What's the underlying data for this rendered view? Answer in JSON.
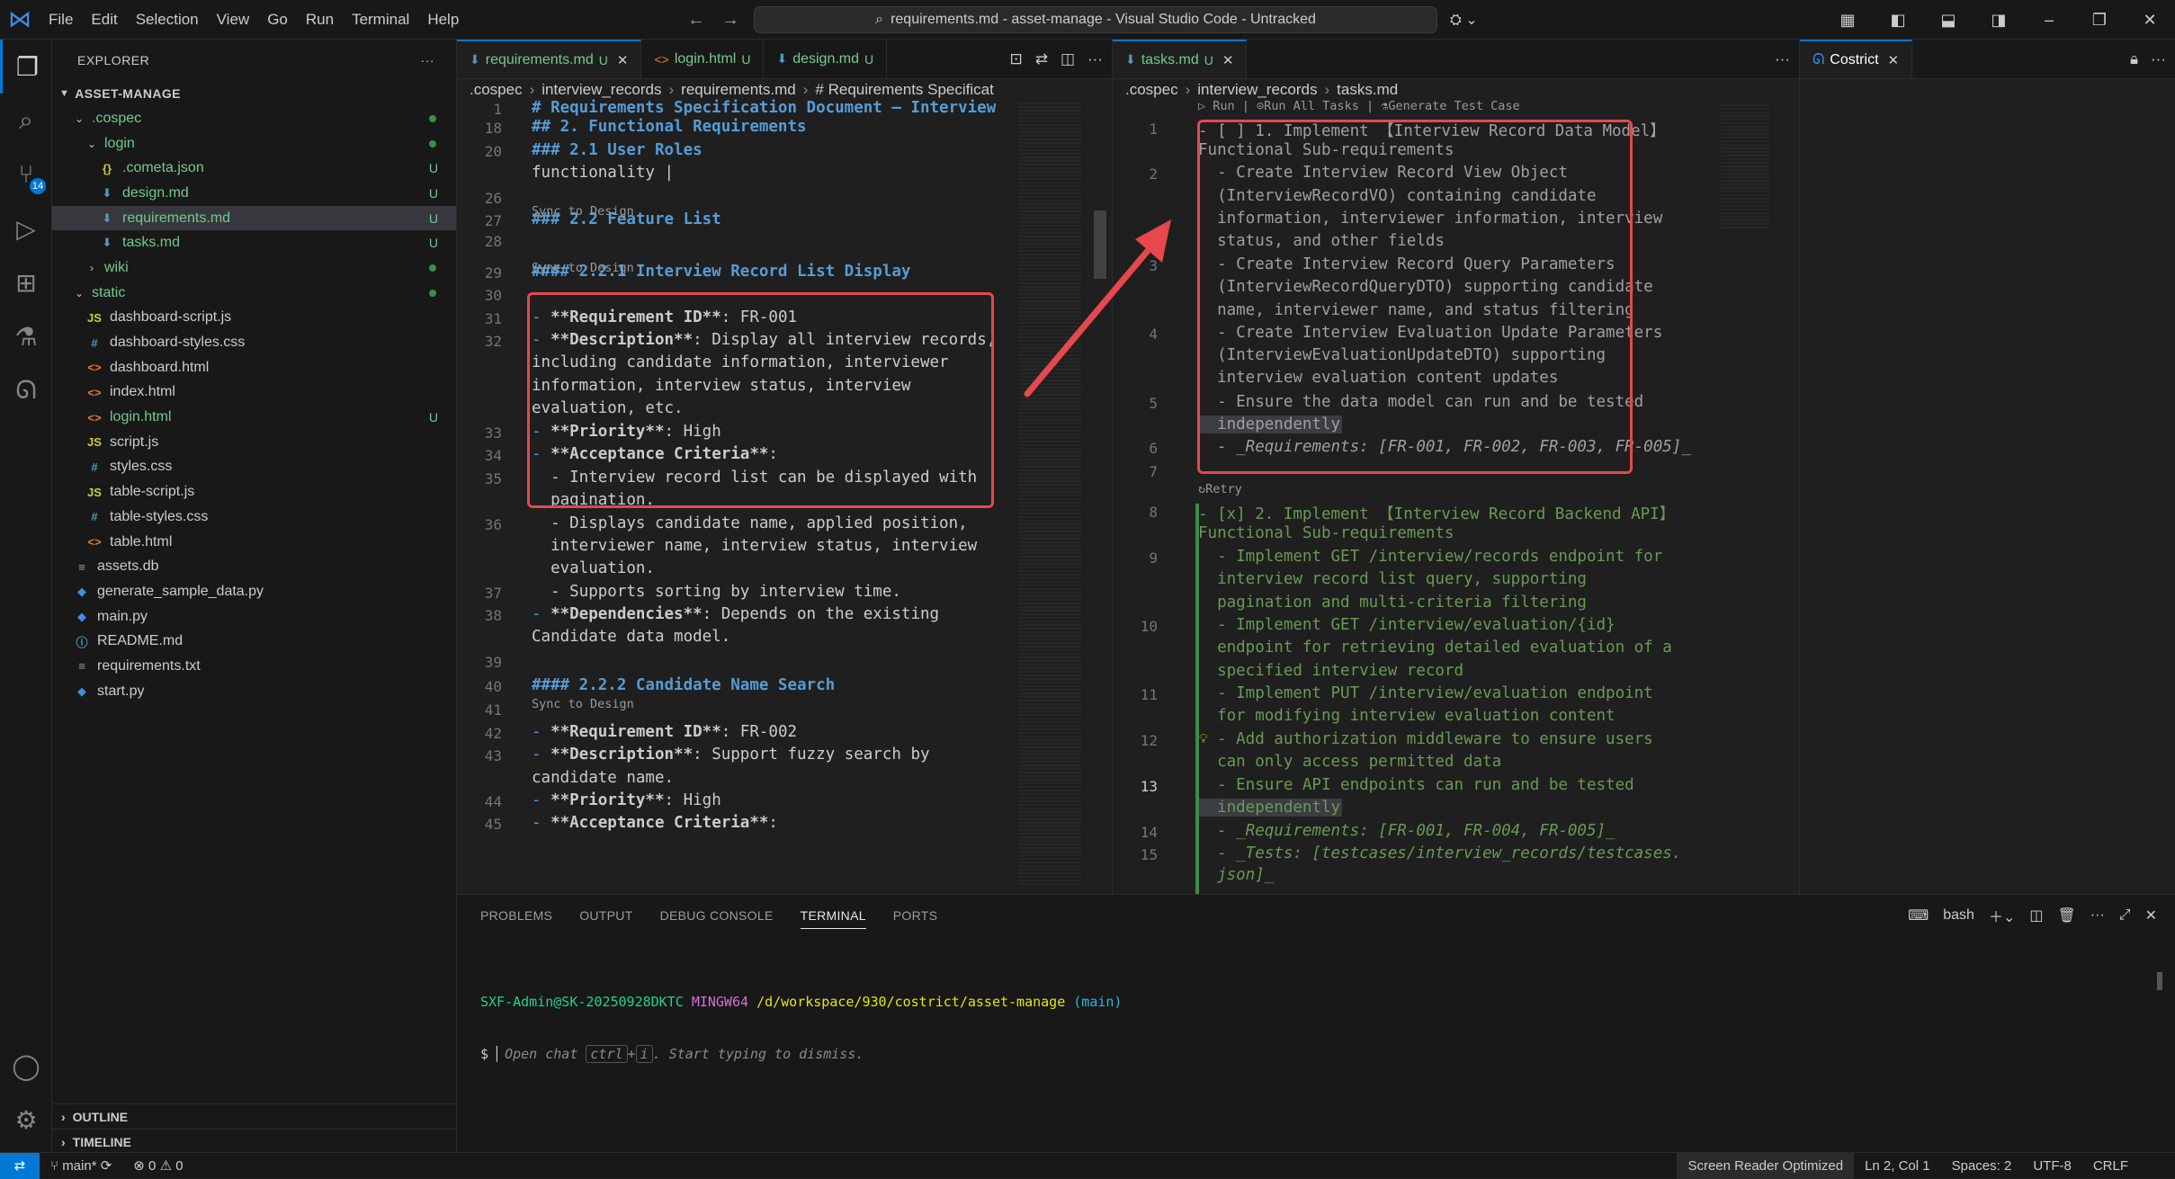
{
  "titlebar": {
    "menus": [
      "File",
      "Edit",
      "Selection",
      "View",
      "Go",
      "Run",
      "Terminal",
      "Help"
    ],
    "title": "requirements.md - asset-manage - Visual Studio Code - Untracked"
  },
  "explorer": {
    "header": "EXPLORER",
    "root": "ASSET-MANAGE",
    "items": [
      {
        "label": ".cospec",
        "kind": "folder-open",
        "depth": 1,
        "status": "dot"
      },
      {
        "label": "login",
        "kind": "folder-open",
        "depth": 2,
        "status": "dot"
      },
      {
        "label": ".cometa.json",
        "kind": "json",
        "depth": 3,
        "status": "U"
      },
      {
        "label": "design.md",
        "kind": "md",
        "depth": 3,
        "status": "U"
      },
      {
        "label": "requirements.md",
        "kind": "md",
        "depth": 3,
        "status": "U",
        "selected": true
      },
      {
        "label": "tasks.md",
        "kind": "md",
        "depth": 3,
        "status": "U"
      },
      {
        "label": "wiki",
        "kind": "folder",
        "depth": 2,
        "status": "dot"
      },
      {
        "label": "static",
        "kind": "folder-open",
        "depth": 1,
        "status": "dot"
      },
      {
        "label": "dashboard-script.js",
        "kind": "js",
        "depth": 2,
        "status": ""
      },
      {
        "label": "dashboard-styles.css",
        "kind": "css",
        "depth": 2,
        "status": ""
      },
      {
        "label": "dashboard.html",
        "kind": "html",
        "depth": 2,
        "status": ""
      },
      {
        "label": "index.html",
        "kind": "html",
        "depth": 2,
        "status": ""
      },
      {
        "label": "login.html",
        "kind": "html",
        "depth": 2,
        "status": "U"
      },
      {
        "label": "script.js",
        "kind": "js",
        "depth": 2,
        "status": ""
      },
      {
        "label": "styles.css",
        "kind": "css",
        "depth": 2,
        "status": ""
      },
      {
        "label": "table-script.js",
        "kind": "js",
        "depth": 2,
        "status": ""
      },
      {
        "label": "table-styles.css",
        "kind": "css",
        "depth": 2,
        "status": ""
      },
      {
        "label": "table.html",
        "kind": "html",
        "depth": 2,
        "status": ""
      },
      {
        "label": "assets.db",
        "kind": "db",
        "depth": 1,
        "status": ""
      },
      {
        "label": "generate_sample_data.py",
        "kind": "py",
        "depth": 1,
        "status": ""
      },
      {
        "label": "main.py",
        "kind": "py",
        "depth": 1,
        "status": ""
      },
      {
        "label": "README.md",
        "kind": "info",
        "depth": 1,
        "status": ""
      },
      {
        "label": "requirements.txt",
        "kind": "txt",
        "depth": 1,
        "status": ""
      },
      {
        "label": "start.py",
        "kind": "py",
        "depth": 1,
        "status": ""
      }
    ],
    "outline": "OUTLINE",
    "timeline": "TIMELINE"
  },
  "left_editor": {
    "tabs": [
      {
        "label": "requirements.md",
        "status": "U",
        "active": true
      },
      {
        "label": "login.html",
        "status": "U",
        "active": false
      },
      {
        "label": "design.md",
        "status": "U",
        "active": false
      }
    ],
    "breadcrumb": [
      ".cospec",
      "interview_records",
      "requirements.md",
      "# Requirements Specificat"
    ],
    "lens_label": "Sync to Design",
    "lines": [
      {
        "n": "1",
        "t": "# Requirements Specification Document – Interview",
        "c": "h"
      },
      {
        "n": "18",
        "t": "## 2. Functional Requirements",
        "c": "h"
      },
      {
        "n": "20",
        "t": "### 2.1 User Roles",
        "c": "h"
      },
      {
        "n": "",
        "t": "functionality |",
        "c": ""
      },
      {
        "n": "26",
        "t": "",
        "c": ""
      },
      {
        "n": "27",
        "t": "### 2.2 Feature List",
        "c": "h"
      },
      {
        "n": "28",
        "t": "",
        "c": ""
      },
      {
        "n": "29",
        "t": "#### 2.2.1 Interview Record List Display",
        "c": "h"
      },
      {
        "n": "30",
        "t": "",
        "c": ""
      },
      {
        "n": "31",
        "t": "- **Requirement ID**: FR-001",
        "c": "b"
      },
      {
        "n": "32",
        "t": "- **Description**: Display all interview records,",
        "c": "b"
      },
      {
        "n": "",
        "t": "including candidate information, interviewer",
        "c": ""
      },
      {
        "n": "",
        "t": "information, interview status, interview",
        "c": ""
      },
      {
        "n": "",
        "t": "evaluation, etc.",
        "c": ""
      },
      {
        "n": "33",
        "t": "- **Priority**: High",
        "c": "b"
      },
      {
        "n": "34",
        "t": "- **Acceptance Criteria**:",
        "c": "b"
      },
      {
        "n": "35",
        "t": "  - Interview record list can be displayed with",
        "c": ""
      },
      {
        "n": "",
        "t": "  pagination.",
        "c": ""
      },
      {
        "n": "36",
        "t": "  - Displays candidate name, applied position,",
        "c": ""
      },
      {
        "n": "",
        "t": "  interviewer name, interview status, interview",
        "c": ""
      },
      {
        "n": "",
        "t": "  evaluation.",
        "c": ""
      },
      {
        "n": "37",
        "t": "  - Supports sorting by interview time.",
        "c": ""
      },
      {
        "n": "38",
        "t": "- **Dependencies**: Depends on the existing",
        "c": "b"
      },
      {
        "n": "",
        "t": "Candidate data model.",
        "c": ""
      },
      {
        "n": "39",
        "t": "",
        "c": ""
      },
      {
        "n": "40",
        "t": "#### 2.2.2 Candidate Name Search",
        "c": "h"
      },
      {
        "n": "41",
        "t": "",
        "c": ""
      },
      {
        "n": "42",
        "t": "- **Requirement ID**: FR-002",
        "c": "b"
      },
      {
        "n": "43",
        "t": "- **Description**: Support fuzzy search by",
        "c": "b"
      },
      {
        "n": "",
        "t": "candidate name.",
        "c": ""
      },
      {
        "n": "44",
        "t": "- **Priority**: High",
        "c": "b"
      },
      {
        "n": "45",
        "t": "- **Acceptance Criteria**:",
        "c": "b"
      }
    ]
  },
  "right_editor": {
    "tabs": [
      {
        "label": "tasks.md",
        "status": "U",
        "active": true
      }
    ],
    "breadcrumb": [
      ".cospec",
      "interview_records",
      "tasks.md"
    ],
    "codelens": [
      "▷ Run",
      "⊙Run All Tasks",
      "⚗Generate Test Case"
    ],
    "retry_label": "↻Retry",
    "lines": [
      {
        "n": "1",
        "t": "- [ ] 1. Implement 【Interview Record Data Model】",
        "c": "gr"
      },
      {
        "n": "",
        "t": "Functional Sub-requirements",
        "c": "gr"
      },
      {
        "n": "2",
        "t": "  - Create Interview Record View Object",
        "c": "gr"
      },
      {
        "n": "",
        "t": "  (InterviewRecordVO) containing candidate",
        "c": "gr"
      },
      {
        "n": "",
        "t": "  information, interviewer information, interview",
        "c": "gr"
      },
      {
        "n": "",
        "t": "  status, and other fields",
        "c": "gr"
      },
      {
        "n": "3",
        "t": "  - Create Interview Record Query Parameters",
        "c": "gr"
      },
      {
        "n": "",
        "t": "  (InterviewRecordQueryDTO) supporting candidate",
        "c": "gr"
      },
      {
        "n": "",
        "t": "  name, interviewer name, and status filtering",
        "c": "gr"
      },
      {
        "n": "4",
        "t": "  - Create Interview Evaluation Update Parameters",
        "c": "gr"
      },
      {
        "n": "",
        "t": "  (InterviewEvaluationUpdateDTO) supporting",
        "c": "gr"
      },
      {
        "n": "",
        "t": "  interview evaluation content updates",
        "c": "gr"
      },
      {
        "n": "5",
        "t": "  - Ensure the data model can run and be tested",
        "c": "gr"
      },
      {
        "n": "",
        "t": "  independently",
        "c": "gr-sel"
      },
      {
        "n": "6",
        "t": "  - _Requirements: [FR-001, FR-002, FR-003, FR-005]_",
        "c": "gr-i"
      },
      {
        "n": "7",
        "t": "",
        "c": ""
      },
      {
        "n": "8",
        "t": "- [x] 2. Implement 【Interview Record Backend API】",
        "c": "g"
      },
      {
        "n": "",
        "t": "Functional Sub-requirements",
        "c": "g"
      },
      {
        "n": "9",
        "t": "  - Implement GET /interview/records endpoint for",
        "c": "g"
      },
      {
        "n": "",
        "t": "  interview record list query, supporting",
        "c": "g"
      },
      {
        "n": "",
        "t": "  pagination and multi-criteria filtering",
        "c": "g"
      },
      {
        "n": "10",
        "t": "  - Implement GET /interview/evaluation/{id}",
        "c": "g"
      },
      {
        "n": "",
        "t": "  endpoint for retrieving detailed evaluation of a",
        "c": "g"
      },
      {
        "n": "",
        "t": "  specified interview record",
        "c": "g"
      },
      {
        "n": "11",
        "t": "  - Implement PUT /interview/evaluation endpoint",
        "c": "g"
      },
      {
        "n": "",
        "t": "  for modifying interview evaluation content",
        "c": "g"
      },
      {
        "n": "12",
        "t": "  - Add authorization middleware to ensure users",
        "c": "g"
      },
      {
        "n": "",
        "t": "  can only access permitted data",
        "c": "g"
      },
      {
        "n": "13",
        "t": "  - Ensure API endpoints can run and be tested",
        "c": "g"
      },
      {
        "n": "",
        "t": "  independently",
        "c": "g-sel"
      },
      {
        "n": "14",
        "t": "  - _Requirements: [FR-001, FR-004, FR-005]_",
        "c": "g-i"
      },
      {
        "n": "15",
        "t": "  - _Tests: [testcases/interview_records/testcases.",
        "c": "g-i"
      },
      {
        "n": "",
        "t": "  json]_",
        "c": "g-i"
      }
    ]
  },
  "chat_tab": {
    "label": "Costrict"
  },
  "panel": {
    "tabs": [
      "PROBLEMS",
      "OUTPUT",
      "DEBUG CONSOLE",
      "TERMINAL",
      "PORTS"
    ],
    "active_tab": "TERMINAL",
    "shell": "bash",
    "prompt_user": "SXF-Admin@SK-20250928DKTC",
    "prompt_env": "MINGW64",
    "prompt_path": "/d/workspace/930/costrict/asset-manage",
    "prompt_branch": "(main)",
    "hint_prefix": "Open chat",
    "hint_key1": "ctrl",
    "hint_plus": "+",
    "hint_key2": "i",
    "hint_suffix": ". Start typing to dismiss."
  },
  "statusbar": {
    "branch": "main*",
    "errors": "0",
    "warnings": "0",
    "screen_reader": "Screen Reader Optimized",
    "cursor": "Ln 2, Col 1",
    "spaces": "Spaces: 2",
    "encoding": "UTF-8",
    "eol": "CRLF"
  },
  "colors": {
    "accent": "#0078d4",
    "git_untracked": "#73c991",
    "annotation": "#e5484d",
    "heading": "#569cd6",
    "done_task": "#6a9955"
  }
}
